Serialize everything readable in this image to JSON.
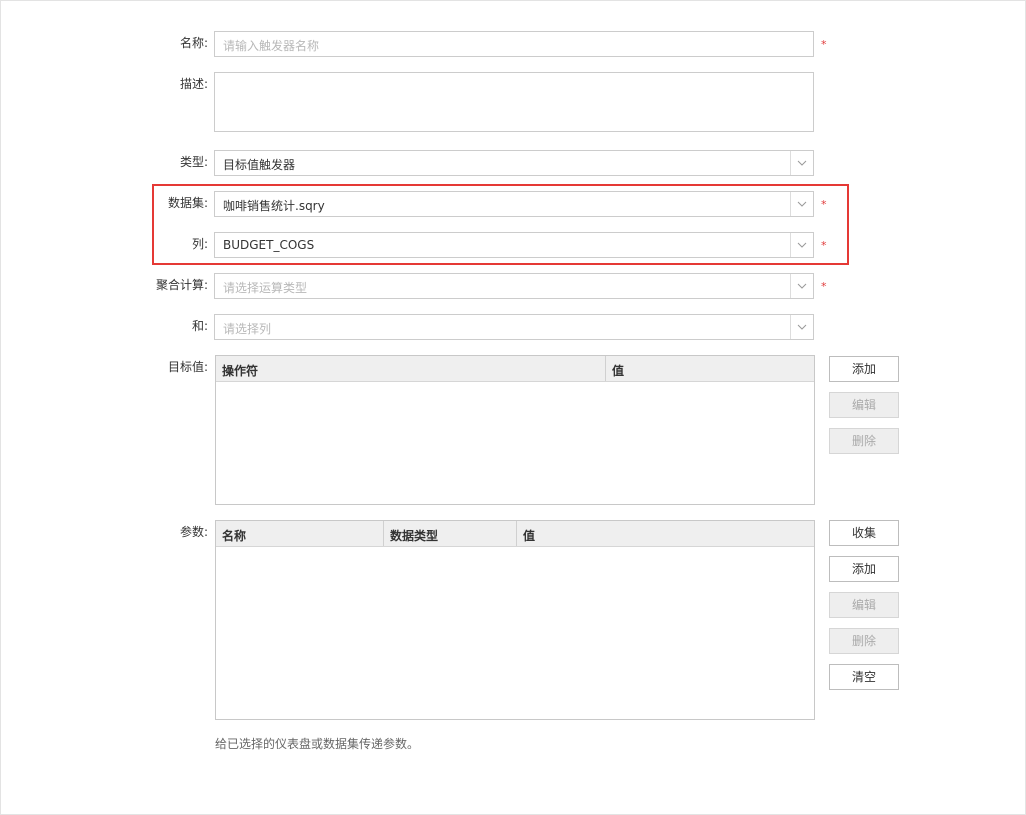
{
  "form": {
    "name": {
      "label": "名称:",
      "placeholder": "请输入触发器名称",
      "required": "*"
    },
    "description": {
      "label": "描述:"
    },
    "type": {
      "label": "类型:",
      "value": "目标值触发器"
    },
    "dataset": {
      "label": "数据集:",
      "value": "咖啡销售统计.sqry",
      "required": "*"
    },
    "column": {
      "label": "列:",
      "value": "BUDGET_COGS",
      "required": "*"
    },
    "aggregate": {
      "label": "聚合计算:",
      "placeholder": "请选择运算类型",
      "required": "*"
    },
    "and": {
      "label": "和:",
      "placeholder": "请选择列"
    }
  },
  "target": {
    "label": "目标值:",
    "columns": [
      "操作符",
      "值"
    ],
    "buttons": {
      "add": "添加",
      "edit": "编辑",
      "delete": "删除"
    }
  },
  "params": {
    "label": "参数:",
    "columns": [
      "名称",
      "数据类型",
      "值"
    ],
    "buttons": {
      "collect": "收集",
      "add": "添加",
      "edit": "编辑",
      "delete": "删除",
      "clear": "清空"
    },
    "hint": "给已选择的仪表盘或数据集传递参数。"
  },
  "colors": {
    "highlight": "#e53935",
    "required": "#e03a3a",
    "disabled_bg": "#eeeeee"
  }
}
